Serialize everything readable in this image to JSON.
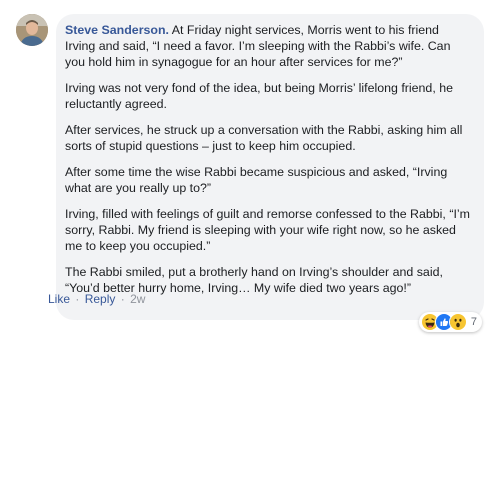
{
  "comment": {
    "author": "Steve Sanderson",
    "paragraphs": [
      "At Friday night services, Morris went to his friend Irving and said, “I need a favor. I’m sleeping with the Rabbi’s wife. Can you hold him in synagogue for an hour after services for me?”",
      "Irving was not very fond of the idea, but being Morris’ lifelong friend, he reluctantly agreed.",
      "After services, he struck up a conversation with the Rabbi, asking him all sorts of stupid questions – just to keep him occupied.",
      "After some time the wise Rabbi became suspicious and asked, “Irving what are you really up to?”",
      "Irving, filled with feelings of guilt and remorse confessed to the Rabbi, “I’m sorry, Rabbi. My friend is sleeping with your wife right now, so he asked me to keep you occupied.”",
      "The Rabbi smiled, put a brotherly hand on Irving’s shoulder and said, “You’d better hurry home, Irving… My wife died two years ago!”"
    ],
    "reactions": {
      "icons": [
        "haha-icon",
        "like-icon",
        "wow-icon"
      ],
      "count": "7"
    },
    "actions": {
      "like": "Like",
      "separator": "·",
      "reply": "Reply",
      "time": "2w"
    }
  },
  "colors": {
    "bubble_bg": "#f2f3f5",
    "link": "#385898",
    "meta": "#90949c",
    "text": "#1c1e21"
  }
}
